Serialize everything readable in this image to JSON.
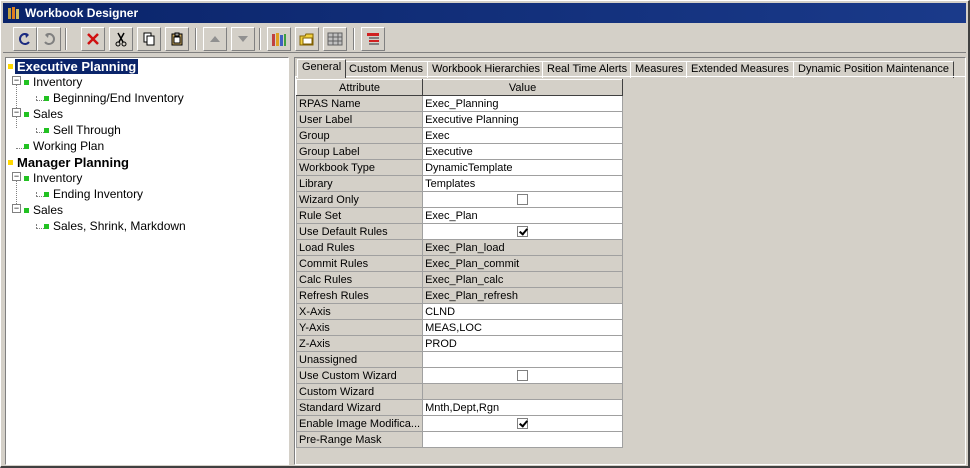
{
  "window": {
    "title": "Workbook Designer"
  },
  "toolbar": {
    "buttons": [
      {
        "icon": "undo-icon"
      },
      {
        "icon": "redo-icon"
      },
      {
        "icon": "delete-icon"
      },
      {
        "icon": "cut-icon"
      },
      {
        "icon": "copy-icon"
      },
      {
        "icon": "paste-icon"
      },
      {
        "icon": "move-up-icon"
      },
      {
        "icon": "move-down-icon"
      },
      {
        "icon": "library-icon"
      },
      {
        "icon": "open-folder-icon"
      },
      {
        "icon": "grid-icon"
      },
      {
        "icon": "hierarchy-icon"
      }
    ]
  },
  "tree": {
    "n0": "Executive Planning",
    "n1": "Inventory",
    "n2": "Beginning/End Inventory",
    "n3": "Sales",
    "n4": "Sell Through",
    "n5": "Working Plan",
    "n6": "Manager Planning",
    "n7": "Inventory",
    "n8": "Ending Inventory",
    "n9": "Sales",
    "n10": "Sales, Shrink, Markdown"
  },
  "tabs": [
    "General",
    "Custom Menus",
    "Workbook Hierarchies",
    "Real Time Alerts",
    "Measures",
    "Extended Measures",
    "Dynamic Position Maintenance"
  ],
  "grid": {
    "headers": {
      "attribute": "Attribute",
      "value": "Value"
    },
    "rows": [
      {
        "attr": "RPAS Name",
        "value": "Exec_Planning",
        "editable": true
      },
      {
        "attr": "User Label",
        "value": "Executive Planning",
        "editable": true
      },
      {
        "attr": "Group",
        "value": "Exec",
        "editable": true
      },
      {
        "attr": "Group Label",
        "value": "Executive",
        "editable": true
      },
      {
        "attr": "Workbook Type",
        "value": "DynamicTemplate",
        "editable": true
      },
      {
        "attr": "Library",
        "value": "Templates",
        "editable": true
      },
      {
        "attr": "Wizard Only",
        "checkbox": false,
        "editable": true
      },
      {
        "attr": "Rule Set",
        "value": "Exec_Plan",
        "editable": true
      },
      {
        "attr": "Use Default Rules",
        "checkbox": true,
        "editable": true
      },
      {
        "attr": "Load Rules",
        "value": "Exec_Plan_load",
        "editable": false
      },
      {
        "attr": "Commit Rules",
        "value": "Exec_Plan_commit",
        "editable": false
      },
      {
        "attr": "Calc Rules",
        "value": "Exec_Plan_calc",
        "editable": false
      },
      {
        "attr": "Refresh Rules",
        "value": "Exec_Plan_refresh",
        "editable": false
      },
      {
        "attr": "X-Axis",
        "value": "CLND",
        "editable": true
      },
      {
        "attr": "Y-Axis",
        "value": "MEAS,LOC",
        "editable": true
      },
      {
        "attr": "Z-Axis",
        "value": "PROD",
        "editable": true
      },
      {
        "attr": "Unassigned",
        "value": "",
        "editable": true
      },
      {
        "attr": "Use Custom Wizard",
        "checkbox": false,
        "editable": true
      },
      {
        "attr": "Custom Wizard",
        "value": "",
        "editable": false
      },
      {
        "attr": "Standard Wizard",
        "value": "Mnth,Dept,Rgn",
        "editable": true
      },
      {
        "attr": "Enable Image Modifica...",
        "checkbox": true,
        "editable": true
      },
      {
        "attr": "Pre-Range Mask",
        "value": "",
        "editable": true
      }
    ]
  },
  "colors": {
    "titlebar": "#0a246a",
    "selection": "#0a246a",
    "face": "#d4d0c8",
    "leaf": "#22c222",
    "root": "#ffd800"
  }
}
